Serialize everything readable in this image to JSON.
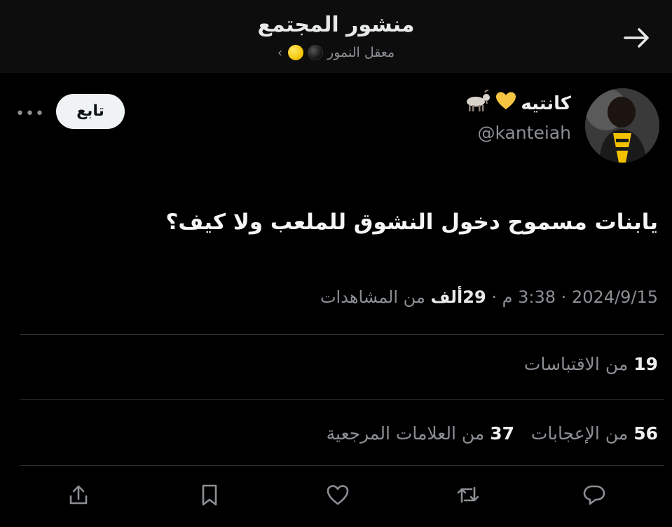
{
  "header": {
    "title": "منشور المجتمع",
    "community_name": "معقل النمور",
    "back_icon": "arrow-right-icon"
  },
  "author": {
    "name": "كانتيه",
    "emojis": [
      "yellow-heart",
      "goat"
    ],
    "handle": "@kanteiah",
    "follow_label": "تابع",
    "more_icon": "more-horizontal-icon"
  },
  "tweet": {
    "text": "يابنات مسموح دخول النشوق للملعب ولا كيف؟"
  },
  "meta": {
    "date": "2024/9/15",
    "time": "3:38 م",
    "views_value": "29ألف",
    "views_label": "من المشاهدات",
    "separator": "·"
  },
  "stats": {
    "quotes_value": "19",
    "quotes_label": "من الاقتباسات",
    "likes_value": "56",
    "likes_label": "من الإعجابات",
    "bookmarks_value": "37",
    "bookmarks_label": "من العلامات المرجعية"
  },
  "actions": [
    "share-icon",
    "bookmark-icon",
    "like-icon",
    "retweet-icon",
    "reply-icon"
  ],
  "colors": {
    "background": "#000000",
    "text_primary": "#e7e9ea",
    "text_secondary": "#8b8f94",
    "divider": "#2f3336"
  }
}
